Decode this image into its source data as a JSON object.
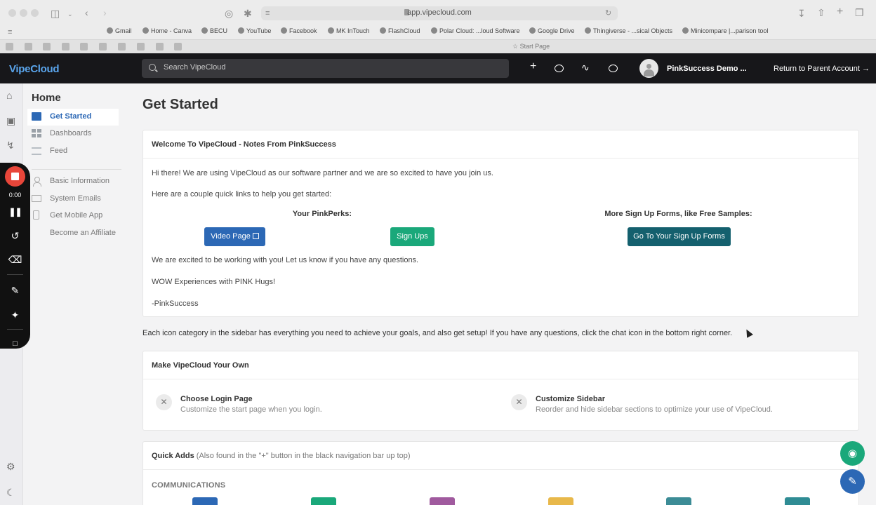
{
  "browser": {
    "url": "app.vipecloud.com",
    "bookmarks": [
      "Gmail",
      "Home - Canva",
      "BECU",
      "YouTube",
      "Facebook",
      "MK InTouch",
      "FlashCloud",
      "Polar Cloud: ...loud Software",
      "Google Drive",
      "Thingiverse - ...sical Objects",
      "Minicompare |...parison tool"
    ],
    "start_tab": "Start Page"
  },
  "appnav": {
    "logo": "VipeCloud",
    "search_placeholder": "Search VipeCloud",
    "user_name": "PinkSuccess Demo ...",
    "return_label": "Return to Parent Account →"
  },
  "recorder": {
    "time": "0:00"
  },
  "sidebar": {
    "title": "Home",
    "items": [
      {
        "label": "Get Started"
      },
      {
        "label": "Dashboards"
      },
      {
        "label": "Feed"
      },
      {
        "label": "Basic Information"
      },
      {
        "label": "System Emails"
      },
      {
        "label": "Get Mobile App"
      },
      {
        "label": "Become an Affiliate"
      }
    ]
  },
  "main": {
    "title": "Get Started",
    "welcome": {
      "header": "Welcome To VipeCloud - Notes From PinkSuccess",
      "intro": "Hi there! We are using VipeCloud as our software partner and we are so excited to have you join us.",
      "links_intro": "Here are a couple quick links to help you get started:",
      "col1_title": "Your PinkPerks:",
      "col2_title": "More Sign Up Forms, like Free Samples:",
      "btn_video": "Video Page",
      "btn_signups": "Sign Ups",
      "btn_forms": "Go To Your Sign Up Forms",
      "outro1": "We are excited to be working with you! Let us know if you have any questions.",
      "outro2": "WOW Experiences with PINK Hugs!",
      "signature": "-PinkSuccess"
    },
    "note": "Each icon category in the sidebar has everything you need to achieve your goals, and also get setup! If you have any questions, click the chat icon in the bottom right corner.",
    "own": {
      "header": "Make VipeCloud Your Own",
      "tasks": [
        {
          "title": "Choose Login Page",
          "desc": "Customize the start page when you login."
        },
        {
          "title": "Customize Sidebar",
          "desc": "Reorder and hide sidebar sections to optimize your use of VipeCloud."
        }
      ]
    },
    "quick": {
      "header": "Quick Adds",
      "header_note": "(Also found in the \"+\" button in the black navigation bar up top)",
      "section": "COMMUNICATIONS",
      "tile_colors": [
        "#2c68b5",
        "#1aa87a",
        "#a05a9e",
        "#e8b84a",
        "#3c8c96",
        "#2f8c94"
      ]
    }
  },
  "colors": {
    "primary_blue": "#2c68b5",
    "green": "#1aa87a",
    "teal_dark": "#14606e",
    "record_red": "#e8463a",
    "fab_green": "#1aa87a",
    "fab_blue": "#2c68b5"
  }
}
